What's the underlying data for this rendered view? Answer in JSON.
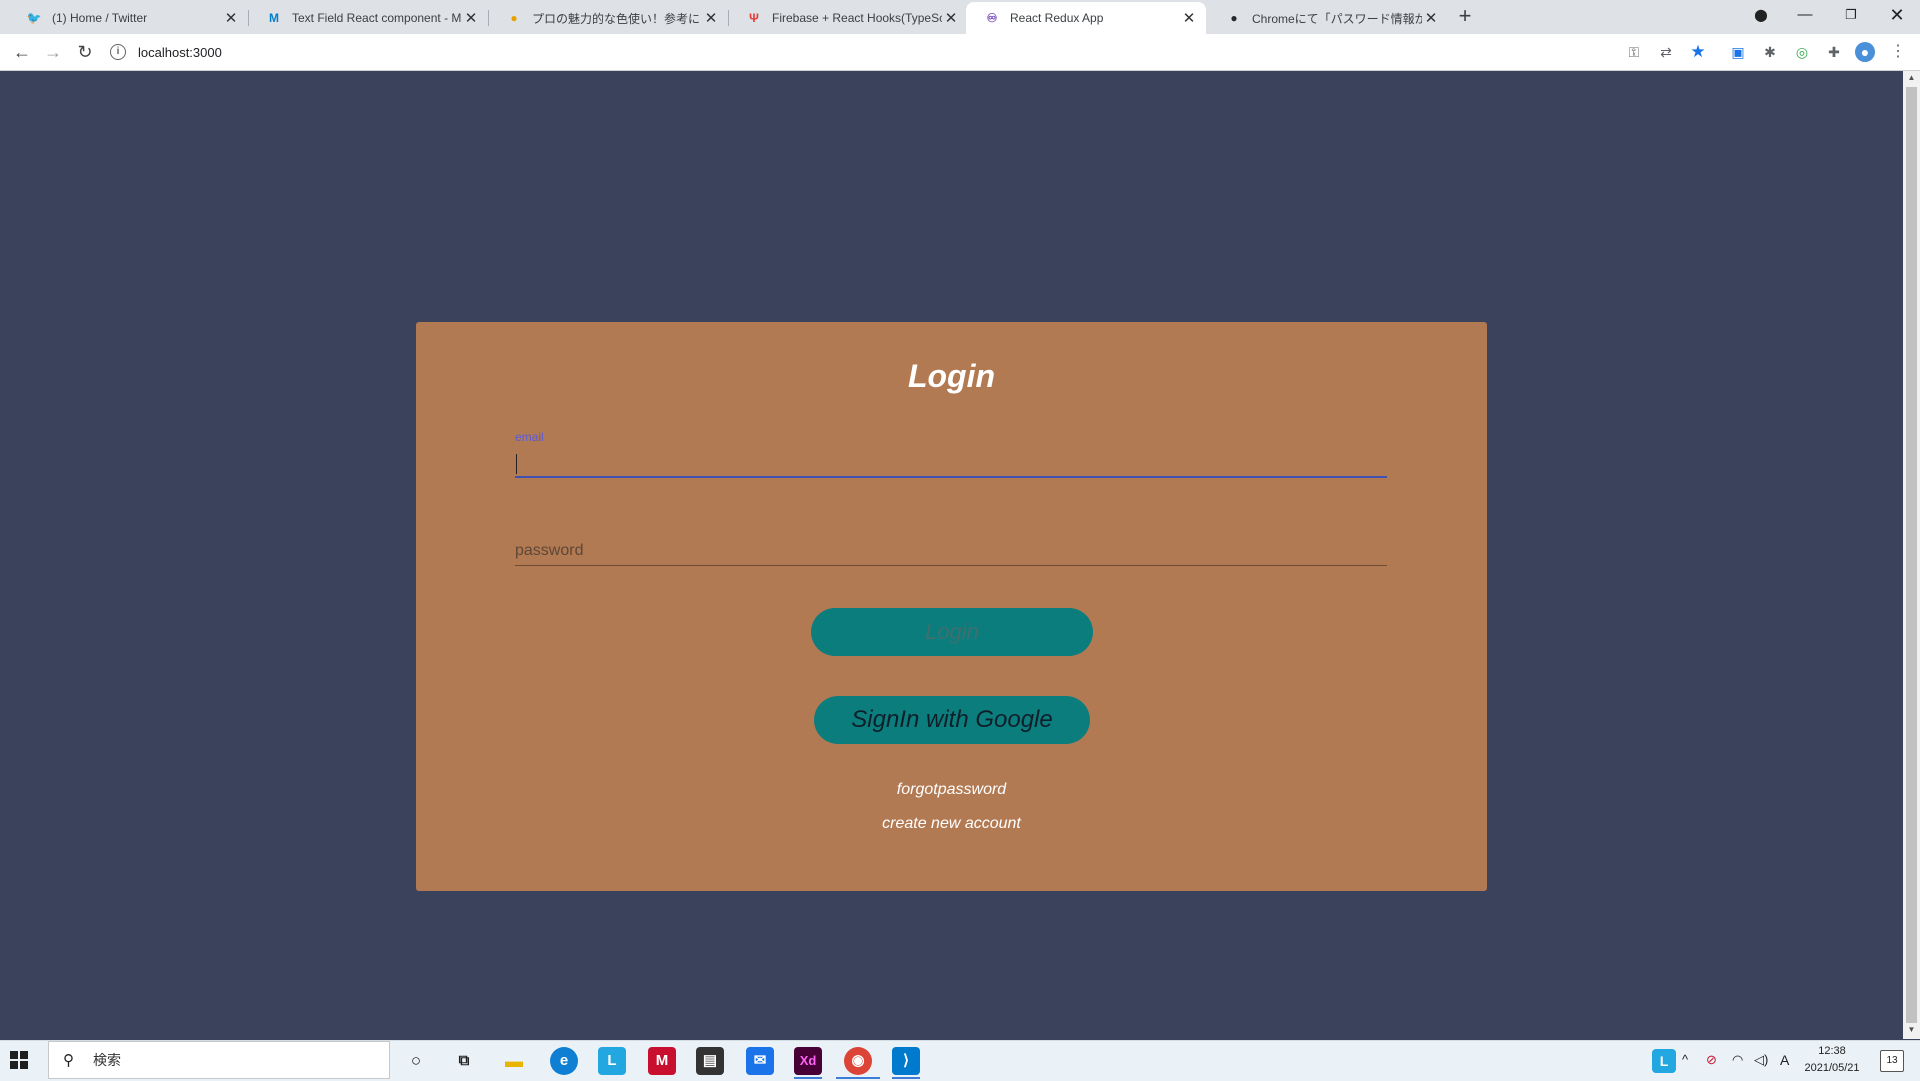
{
  "browser": {
    "tabs": [
      {
        "title": "(1) Home / Twitter",
        "icon": "twitter-icon",
        "color": "#1d9bf0",
        "glyph": "🐦"
      },
      {
        "title": "Text Field React component - Mat",
        "icon": "material-ui-icon",
        "color": "#0081cb",
        "glyph": "M"
      },
      {
        "title": "プロの魅力的な色使い！参考にした",
        "icon": "site-icon",
        "color": "#e8a200",
        "glyph": "●"
      },
      {
        "title": "Firebase + React Hooks(TypeScri",
        "icon": "qiita-icon",
        "color": "#e53935",
        "glyph": "Ψ"
      },
      {
        "title": "React Redux App",
        "icon": "redux-icon",
        "color": "#764abc",
        "glyph": "♾"
      },
      {
        "title": "Chromeにて「パスワード情報が漏洩し",
        "icon": "github-icon",
        "color": "#24292e",
        "glyph": "●"
      }
    ],
    "active_tab_index": 4,
    "address": "localhost:3000"
  },
  "login": {
    "title": "Login",
    "email_label": "email",
    "password_placeholder": "password",
    "login_button": "Login",
    "google_button": "SignIn with Google",
    "forgot_link": "forgotpassword",
    "create_link": "create new account"
  },
  "colors": {
    "page_bg": "#3b435c",
    "card_bg": "#b27a53",
    "button_bg": "#0b7d7d",
    "focus_line": "#3f51b5"
  },
  "taskbar": {
    "search_placeholder": "検索",
    "time": "12:38",
    "date": "2021/05/21",
    "notification_count": "13",
    "ime_indicator": "A"
  }
}
